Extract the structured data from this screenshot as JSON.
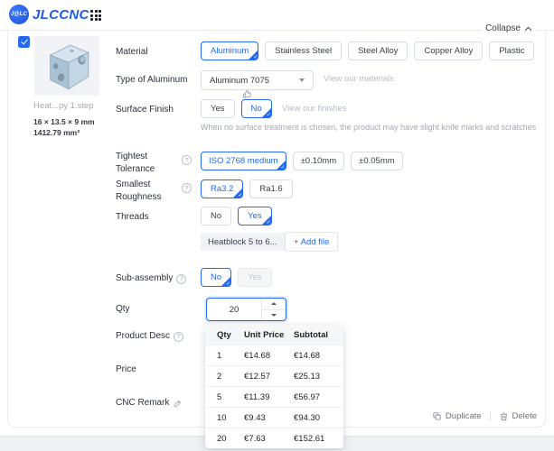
{
  "header": {
    "logo_badge": "J@LC",
    "brand": "JLCCNC"
  },
  "collapse": {
    "label": "Collapse"
  },
  "part": {
    "name": "Heat...py 1.step",
    "dimensions": "16 × 13.5 × 9 mm",
    "volume": "1412.79 mm³"
  },
  "form": {
    "material": {
      "label": "Material",
      "options": [
        "Aluminum",
        "Stainless Steel",
        "Steel Alloy",
        "Copper Alloy",
        "Plastic"
      ],
      "selected": "Aluminum"
    },
    "type_of_aluminum": {
      "label": "Type of Aluminum",
      "value": "Aluminum 7075",
      "link": "View our materials"
    },
    "surface_finish": {
      "label": "Surface Finish",
      "options": [
        "Yes",
        "No"
      ],
      "selected": "No",
      "link": "View our finishes",
      "note": "When no surface treatment is chosen, the product may have slight knife marks and scratches"
    },
    "tightest_tolerance": {
      "label": "Tightest Tolerance",
      "options": [
        "ISO 2768 medium",
        "±0.10mm",
        "±0.05mm"
      ],
      "selected": "ISO 2768 medium"
    },
    "smallest_roughness": {
      "label": "Smallest Roughness",
      "options": [
        "Ra3.2",
        "Ra1.6"
      ],
      "selected": "Ra3.2"
    },
    "threads": {
      "label": "Threads",
      "options": [
        "No",
        "Yes"
      ],
      "selected": "Yes",
      "file_tag": "Heatblock 5 to 6...",
      "add_file": "+ Add file"
    },
    "sub_assembly": {
      "label": "Sub-assembly",
      "options": [
        "No",
        "Yes"
      ],
      "selected": "No",
      "disabled_option": "Yes"
    },
    "qty": {
      "label": "Qty",
      "value": "20"
    },
    "product_desc": {
      "label": "Product Desc"
    },
    "price": {
      "label": "Price"
    },
    "cnc_remark": {
      "label": "CNC Remark"
    }
  },
  "price_table": {
    "headers": [
      "Qty",
      "Unit Price",
      "Subtotal"
    ],
    "rows": [
      [
        "1",
        "€14.68",
        "€14.68"
      ],
      [
        "2",
        "€12.57",
        "€25.13"
      ],
      [
        "5",
        "€11.39",
        "€56.97"
      ],
      [
        "10",
        "€9.43",
        "€94.30"
      ],
      [
        "20",
        "€7.63",
        "€152.61"
      ]
    ]
  },
  "actions": {
    "duplicate": "Duplicate",
    "delete": "Delete"
  },
  "colors": {
    "accent": "#2468f2"
  }
}
